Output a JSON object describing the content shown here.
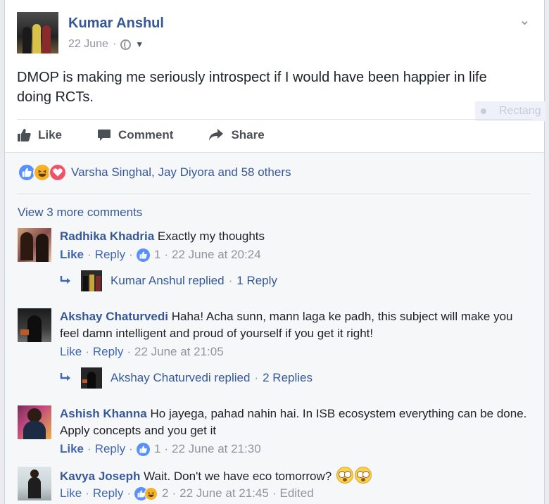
{
  "post": {
    "author": "Kumar Anshul",
    "date": "22 June",
    "date_separator": "·",
    "privacy_icon": "globe-icon",
    "text": "DMOP is making me seriously introspect if I would have been happier in life doing RCTs.",
    "ghost_overlay": "Rectang"
  },
  "actions": {
    "like": "Like",
    "comment": "Comment",
    "share": "Share"
  },
  "reactions": {
    "icons": [
      "like-icon",
      "haha-icon",
      "love-icon"
    ],
    "text": "Varsha Singhal, Jay Diyora and 58 others"
  },
  "view_more": "View 3 more comments",
  "comments": [
    {
      "name": "Radhika Khadria",
      "text": "Exactly my thoughts",
      "like": "Like",
      "reply": "Reply",
      "reaction_count": "1",
      "time": "22 June at 20:24",
      "reply_summary": {
        "who": "Kumar Anshul replied",
        "count": "1 Reply"
      }
    },
    {
      "name": "Akshay Chaturvedi",
      "text": "Haha! Acha sunn, mann laga ke padh, this subject will make you feel damn intelligent and proud of yourself if you get it right!",
      "like": "Like",
      "reply": "Reply",
      "time": "22 June at 21:05",
      "reply_summary": {
        "who": "Akshay Chaturvedi replied",
        "count": "2 Replies"
      }
    },
    {
      "name": "Ashish Khanna",
      "text": "Ho jayega, pahad nahin hai. In ISB ecosystem everything can be done. Apply concepts and you get it",
      "like": "Like",
      "reply": "Reply",
      "reaction_count": "1",
      "time": "22 June at 21:30"
    },
    {
      "name": "Kavya Joseph",
      "text": "Wait. Don't we have eco tomorrow?",
      "like": "Like",
      "reply": "Reply",
      "reaction_count": "2",
      "time": "22 June at 21:45",
      "edited": "Edited"
    }
  ],
  "sep": "·"
}
